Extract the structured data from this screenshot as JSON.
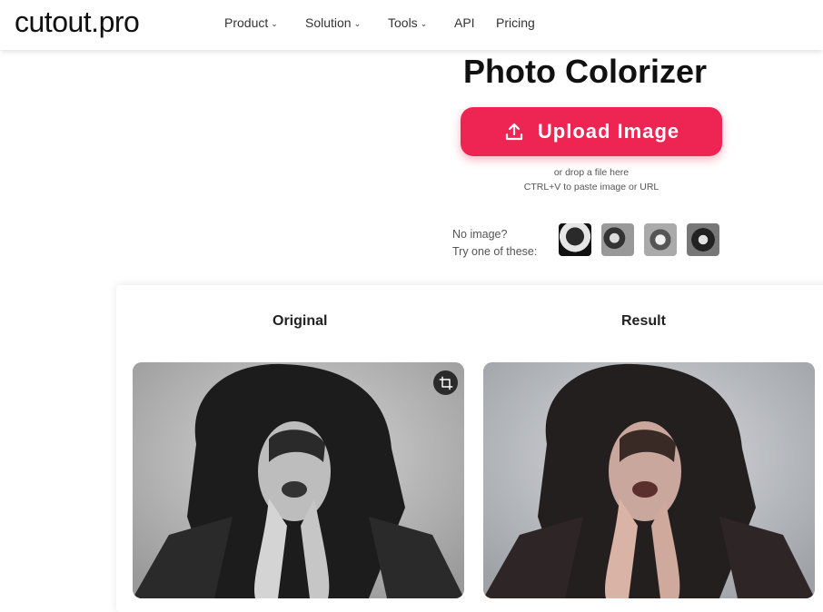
{
  "header": {
    "logo": "cutout.pro",
    "nav": [
      {
        "label": "Product",
        "has_dropdown": true
      },
      {
        "label": "Solution",
        "has_dropdown": true
      },
      {
        "label": "Tools",
        "has_dropdown": true
      },
      {
        "label": "API",
        "has_dropdown": false
      },
      {
        "label": "Pricing",
        "has_dropdown": false
      }
    ]
  },
  "hero": {
    "title": "Photo Colorizer",
    "upload_label": "Upload Image",
    "upload_icon": "upload-icon",
    "drop_hint_line1": "or drop a file here",
    "drop_hint_line2": "CTRL+V to paste image or URL"
  },
  "samples": {
    "line1": "No image?",
    "line2": "Try one of these:"
  },
  "comparison": {
    "original_label": "Original",
    "result_label": "Result",
    "crop_icon": "crop-icon"
  },
  "colors": {
    "accent": "#ee2552",
    "text_dark": "#111111"
  }
}
